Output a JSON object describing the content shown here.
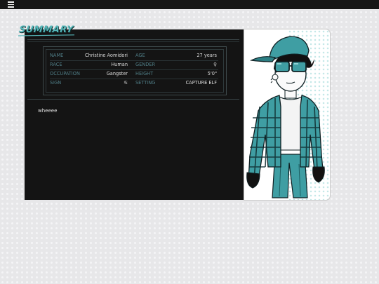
{
  "summary": {
    "title": "SUMMARY"
  },
  "fields": [
    {
      "label": "NAME",
      "value": "Christine Aomidori"
    },
    {
      "label": "AGE",
      "value": "27 years"
    },
    {
      "label": "RACE",
      "value": "Human"
    },
    {
      "label": "GENDER",
      "value": "♀"
    },
    {
      "label": "OCCUPATION",
      "value": "Gangster"
    },
    {
      "label": "HEIGHT",
      "value": "5'0\""
    },
    {
      "label": "SIGN",
      "value": "♋"
    },
    {
      "label": "SETTING",
      "value": "CAPTURE ELF"
    }
  ],
  "description": "wheeee",
  "icons": {
    "menu": "hamburger-menu-icon",
    "character": "character-portrait"
  },
  "colors": {
    "accent": "#55b5b7",
    "label": "#4f7d86",
    "panel": "#141414",
    "teal": "#3f9ea3"
  }
}
